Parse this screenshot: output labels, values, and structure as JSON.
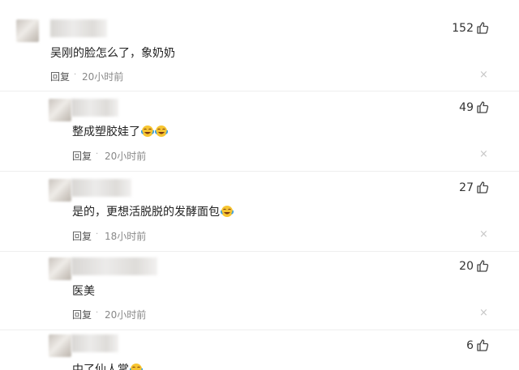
{
  "comments": [
    {
      "likes": "152",
      "text": "吴刚的脸怎么了，象奶奶",
      "emoji_count": 0,
      "reply_label": "回复",
      "separator": "·",
      "time": "20小时前",
      "close_glyph": "×"
    },
    {
      "likes": "49",
      "text": "整成塑胶娃了",
      "emoji_count": 2,
      "reply_label": "回复",
      "separator": "·",
      "time": "20小时前",
      "close_glyph": "×"
    },
    {
      "likes": "27",
      "text": "是的，更想活脱脱的发酵面包",
      "emoji_count": 1,
      "reply_label": "回复",
      "separator": "·",
      "time": "18小时前",
      "close_glyph": "×"
    },
    {
      "likes": "20",
      "text": "医美",
      "emoji_count": 0,
      "reply_label": "回复",
      "separator": "·",
      "time": "20小时前",
      "close_glyph": "×"
    },
    {
      "likes": "6",
      "text": "中了仙人掌",
      "emoji_count": 1
    }
  ],
  "icons": {
    "thumb": "thumbs-up-icon",
    "emoji": "laughing-crying-emoji-icon",
    "close": "close-icon"
  },
  "colors": {
    "divider": "#eeeeee",
    "secondary_text": "#888888",
    "emoji_face": "#f7c531",
    "emoji_tear": "#3aa0e6"
  }
}
